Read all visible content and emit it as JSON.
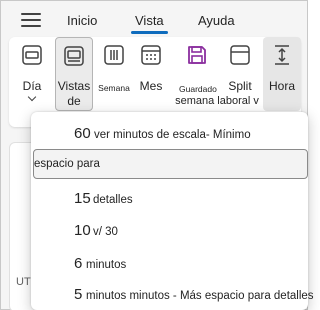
{
  "menubar": {
    "tabs": [
      {
        "label": "Inicio"
      },
      {
        "label": "Vista"
      },
      {
        "label": "Ayuda"
      }
    ]
  },
  "ribbon": {
    "dia": "Día",
    "vistas_de_line1": "Vistas",
    "vistas_de_line2": "de",
    "semana": "Semana",
    "mes": "Mes",
    "guardado": "Guardado",
    "split": "Split",
    "semana_laboral": "semana laboral v",
    "hora": "Hora"
  },
  "menu": {
    "items": [
      {
        "num": "60",
        "text": "ver minutos de escala- Mínimo"
      },
      {
        "num": "",
        "text": "espacio para"
      },
      {
        "num": "15",
        "text": "detalles"
      },
      {
        "num": "10",
        "text": "v/ 30"
      },
      {
        "num": "6",
        "text": "minutos"
      },
      {
        "num": "5",
        "text": "minutos minutos - Más espacio para detalles"
      }
    ]
  },
  "background": {
    "utc": "UT("
  },
  "colors": {
    "accent": "#0f6cbd",
    "guardado_icon": "#8a2e9e"
  }
}
